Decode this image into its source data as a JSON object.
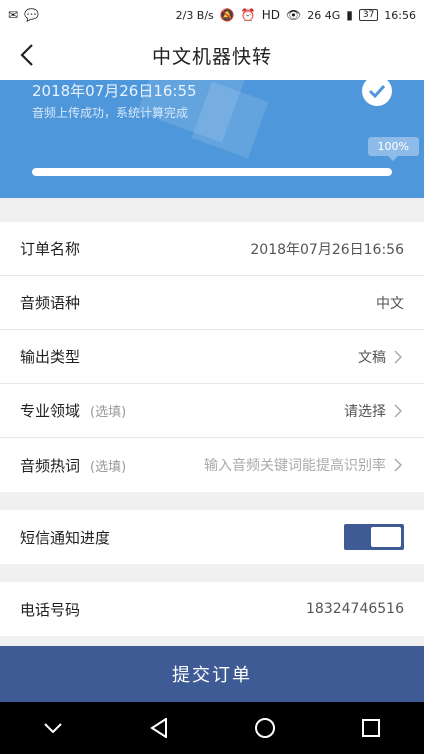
{
  "status_bar": {
    "left_icons": [
      "notification-icon",
      "wechat-icon"
    ],
    "speed": "2/3 B/s",
    "network": "26 4G",
    "battery": "37",
    "time": "16:56"
  },
  "header": {
    "title": "中文机器快转"
  },
  "banner": {
    "date": "2018年07月26日16:55",
    "status": "音频上传成功，系统计算完成",
    "progress_label": "100%",
    "progress": 1.0,
    "color": "#4e97da"
  },
  "form": {
    "order_name": {
      "label": "订单名称",
      "value": "2018年07月26日16:56"
    },
    "audio_lang": {
      "label": "音频语种",
      "value": "中文"
    },
    "output_type": {
      "label": "输出类型",
      "value": "文稿"
    },
    "domain": {
      "label": "专业领域",
      "hint": "(选填)",
      "value": "请选择"
    },
    "hotwords": {
      "label": "音频热词",
      "hint": "(选填)",
      "placeholder": "输入音频关键词能提高识别率"
    },
    "sms_notify": {
      "label": "短信通知进度",
      "enabled": true
    },
    "phone": {
      "label": "电话号码",
      "value": "18324746516"
    }
  },
  "submit": {
    "label": "提交订单",
    "color": "#3f5b96"
  },
  "navbar": {
    "buttons": [
      "chevron-down-icon",
      "back-triangle-icon",
      "home-circle-icon",
      "recents-square-icon"
    ]
  }
}
